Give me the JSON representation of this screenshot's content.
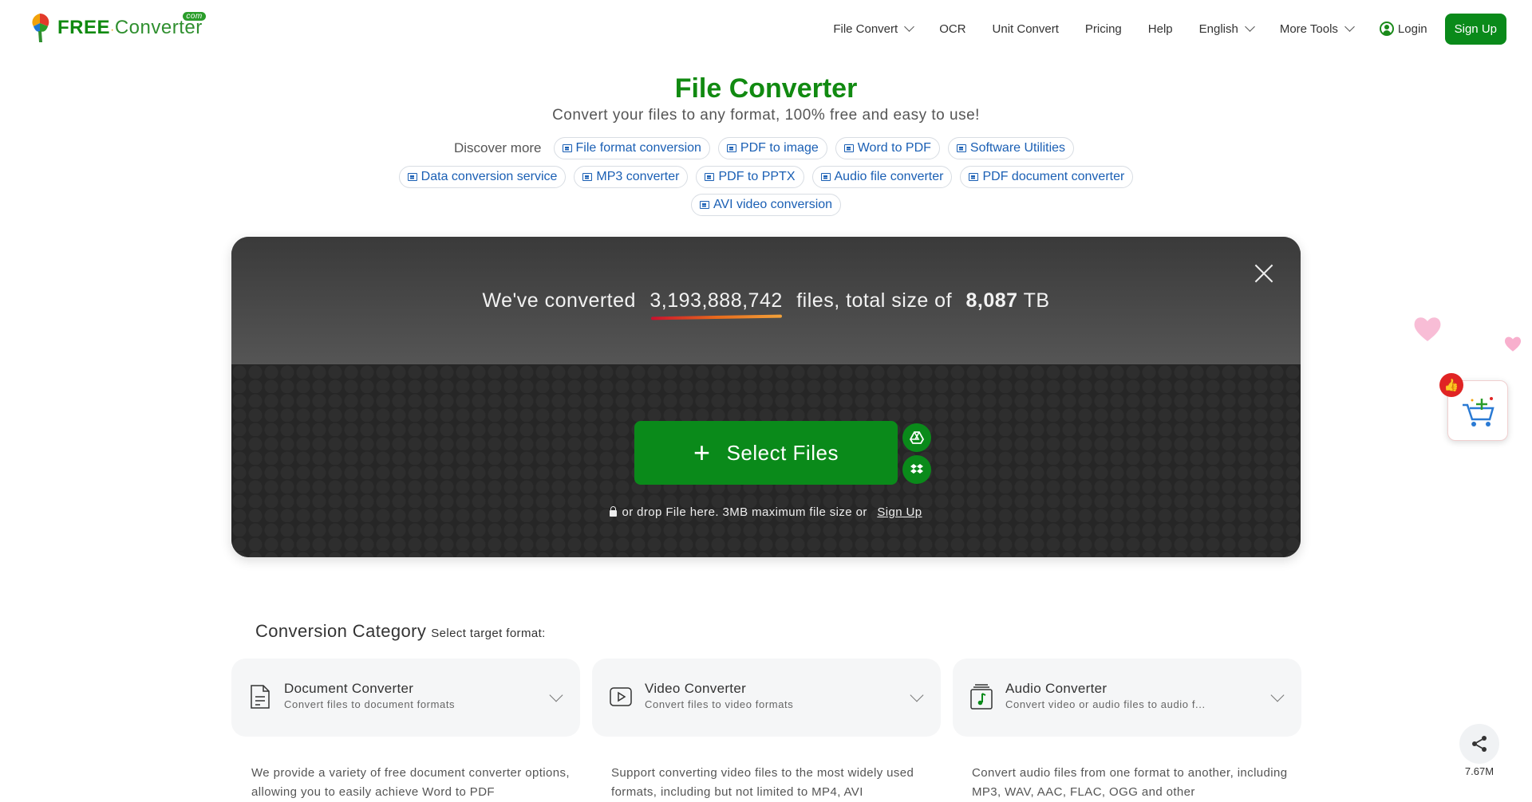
{
  "logo": {
    "free": "FREE",
    "dot": "·",
    "converter": "Converter",
    "com": "com"
  },
  "nav": {
    "items": [
      {
        "label": "File Convert",
        "dropdown": true
      },
      {
        "label": "OCR",
        "dropdown": false
      },
      {
        "label": "Unit Convert",
        "dropdown": false
      },
      {
        "label": "Pricing",
        "dropdown": false
      },
      {
        "label": "Help",
        "dropdown": false
      },
      {
        "label": "English",
        "dropdown": true
      },
      {
        "label": "More Tools",
        "dropdown": true
      }
    ],
    "login": "Login",
    "signup": "Sign Up"
  },
  "hero": {
    "title": "File Converter",
    "subtitle": "Convert your files to any format, 100% free and easy to use!",
    "discover_label": "Discover more",
    "chips": [
      "File format conversion",
      "PDF to image",
      "Word to PDF",
      "Software Utilities",
      "Data conversion service",
      "MP3 converter",
      "PDF to PPTX",
      "Audio file converter",
      "PDF document converter",
      "AVI video conversion"
    ]
  },
  "panel": {
    "stats_prefix": "We've converted",
    "files_count": "3,193,888,742",
    "stats_middle": "files, total size of",
    "total_size": "8,087",
    "size_unit": "TB",
    "select_files": "Select Files",
    "plus": "+",
    "drop_text": "or drop File here. 3MB maximum file size or",
    "drop_signup": "Sign Up"
  },
  "category": {
    "title": "Conversion Category",
    "subtitle": "Select target format:",
    "cards": [
      {
        "title": "Document Converter",
        "subtitle": "Convert files to document formats",
        "icon": "document-icon",
        "description": "We provide a variety of free document converter options, allowing you to easily achieve Word to PDF"
      },
      {
        "title": "Video Converter",
        "subtitle": "Convert files to video formats",
        "icon": "video-icon",
        "description": "Support converting video files to the most widely used formats, including but not limited to MP4, AVI"
      },
      {
        "title": "Audio Converter",
        "subtitle": "Convert video or audio files to audio f...",
        "icon": "audio-icon",
        "description": "Convert audio files from one format to another, including MP3, WAV, AAC, FLAC, OGG and other"
      }
    ]
  },
  "floating": {
    "share_count": "7.67M",
    "thumb": "👍"
  },
  "colors": {
    "brand_green": "#0a8a1a",
    "link_blue": "#1a5fb4",
    "panel_dark": "#232323"
  }
}
